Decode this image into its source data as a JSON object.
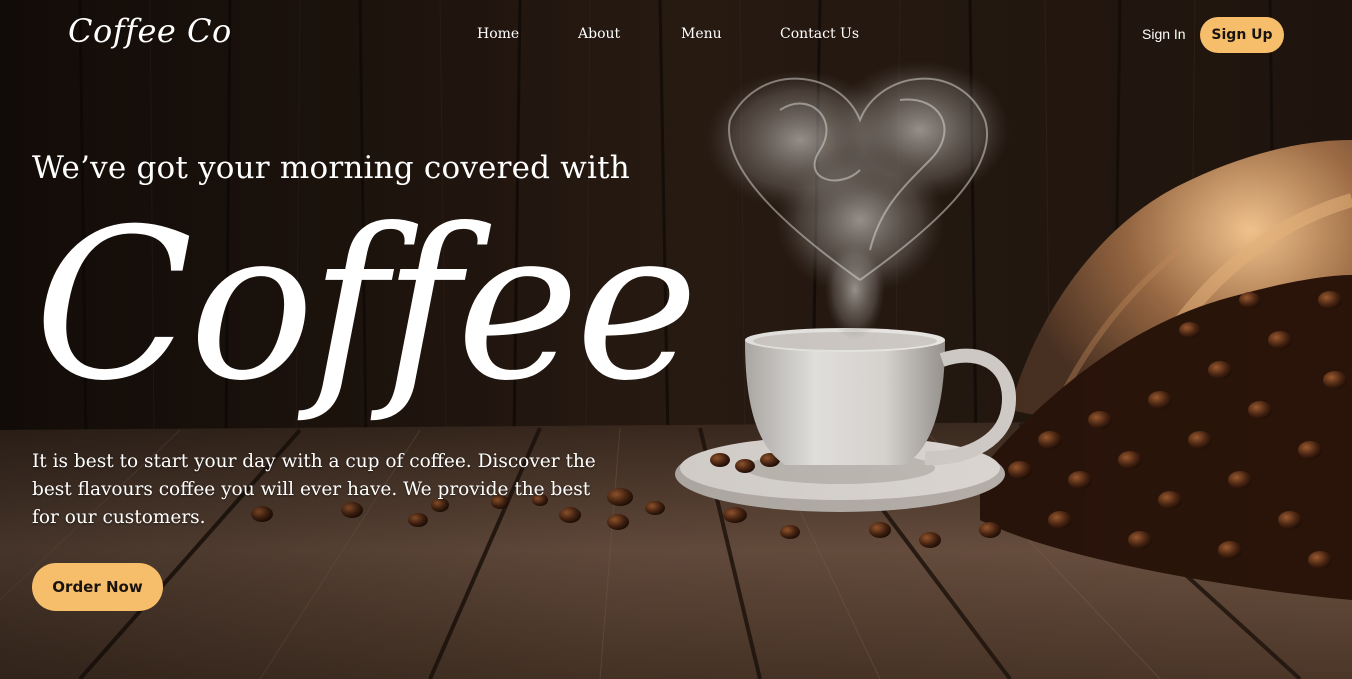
{
  "brand": {
    "logo": "Coffee Co"
  },
  "nav": {
    "links": [
      {
        "label": "Home"
      },
      {
        "label": "About"
      },
      {
        "label": "Menu"
      },
      {
        "label": "Contact Us"
      }
    ],
    "sign_in": "Sign In",
    "sign_up": "Sign Up"
  },
  "hero": {
    "subtitle": "We’ve got your morning covered with",
    "headline": "Coffee",
    "description": "It is best to start your day with a cup of coffee. Discover the best flavours coffee you will ever have. We provide the best for our customers.",
    "cta": "Order Now"
  },
  "theme": {
    "accent": "#f6bd6a",
    "button_text": "#1a1410",
    "text": "#ffffff"
  }
}
